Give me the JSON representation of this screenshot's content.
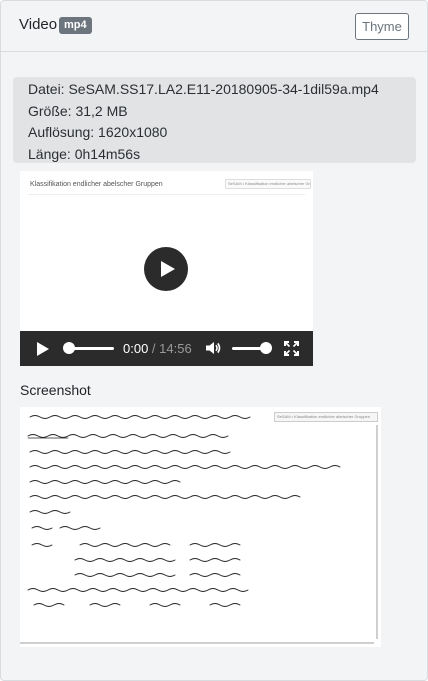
{
  "header": {
    "title": "Video",
    "format_badge": "mp4",
    "theme_button_label": "Thyme"
  },
  "file_info": {
    "filename_line": "Datei: SeSAM.SS17.LA2.E11-20180905-34-1dil59a.mp4",
    "size_line": "Größe: 31,2 MB",
    "resolution_line": "Auflösung: 1620x1080",
    "length_line": "Länge: 0h14m56s"
  },
  "player": {
    "slide_title": "Klassifikation endlicher abelscher Gruppen",
    "slide_tab": "SeSAM • Klassifikation endlicher abelscher Gruppen",
    "current_time": "0:00",
    "separator": " / ",
    "duration": "14:56",
    "progress": 0,
    "volume": 1,
    "icons": [
      "play-icon",
      "volume-icon",
      "fullscreen-icon"
    ]
  },
  "screenshot": {
    "label": "Screenshot",
    "tab_text": "SeSAM • Klassifikation endlicher abelscher Gruppen"
  },
  "colors": {
    "card_bg": "#f3f4f5",
    "info_bg": "#e2e3e5",
    "badge_bg": "#6c757d",
    "control_bar": "#2b2b2b"
  }
}
